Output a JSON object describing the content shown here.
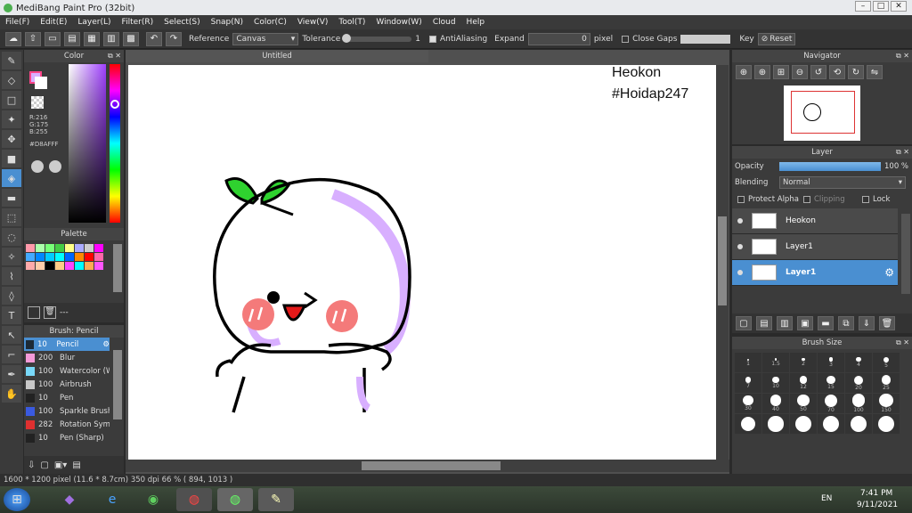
{
  "window": {
    "title": "MediBang Paint Pro (32bit)"
  },
  "menu": [
    "File(F)",
    "Edit(E)",
    "Layer(L)",
    "Filter(R)",
    "Select(S)",
    "Snap(N)",
    "Color(C)",
    "View(V)",
    "Tool(T)",
    "Window(W)",
    "Cloud",
    "Help"
  ],
  "toolbar": {
    "reference_label": "Reference",
    "reference_value": "Canvas",
    "tolerance_label": "Tolerance",
    "tolerance_value": "1",
    "antialiasing_label": "AntiAliasing",
    "expand_label": "Expand",
    "expand_value": "0",
    "expand_unit": "pixel",
    "close_gaps_label": "Close Gaps",
    "key_label": "Key",
    "reset_label": "Reset"
  },
  "color_panel": {
    "title": "Color",
    "r": "R:216",
    "g": "G:175",
    "b": "B:255",
    "hex": "#D8AFFF",
    "fg_color": "#D8AFFF"
  },
  "palette_panel": {
    "title": "Palette",
    "tail_text": "---",
    "swatches": [
      "#f9a",
      "#afa",
      "#7f7",
      "#4c4",
      "#ff8",
      "#aaf",
      "#ccc",
      "#f0f",
      "#4af",
      "#08f",
      "#0cf",
      "#0ff",
      "#06f",
      "#f80",
      "#f00",
      "#f6a",
      "#faa",
      "#fca",
      "#000",
      "#fc8",
      "#f4f",
      "#0ff",
      "#fa5",
      "#f5f"
    ]
  },
  "brush_panel": {
    "title": "Brush: Pencil",
    "brushes": [
      {
        "size": "10",
        "name": "Pencil",
        "color": "#1d2a36"
      },
      {
        "size": "200",
        "name": "Blur",
        "color": "#f49ad8"
      },
      {
        "size": "100",
        "name": "Watercolor (W",
        "color": "#78d8f8"
      },
      {
        "size": "100",
        "name": "Airbrush",
        "color": "#c8c8c8"
      },
      {
        "size": "10",
        "name": "Pen",
        "color": "#222"
      },
      {
        "size": "100",
        "name": "Sparkle Brush",
        "color": "#3a5ae0"
      },
      {
        "size": "282",
        "name": "Rotation Sym",
        "color": "#e03030"
      },
      {
        "size": "10",
        "name": "Pen (Sharp)",
        "color": "#222"
      }
    ]
  },
  "document": {
    "tab": "Untitled",
    "note_line1": "Heokon",
    "note_line2": "#Hoidap247"
  },
  "navigator": {
    "title": "Navigator"
  },
  "layer_panel": {
    "title": "Layer",
    "opacity_label": "Opacity",
    "opacity_value": "100 %",
    "opacity_fraction": 1.0,
    "blending_label": "Blending",
    "blending_value": "Normal",
    "protect_alpha": "Protect Alpha",
    "clipping": "Clipping",
    "lock": "Lock",
    "layers": [
      {
        "name": "Heokon",
        "active": false
      },
      {
        "name": "Layer1",
        "active": false
      },
      {
        "name": "Layer1",
        "active": true
      }
    ]
  },
  "brush_size_panel": {
    "title": "Brush Size",
    "sizes": [
      "1",
      "1.5",
      "2",
      "3",
      "4",
      "5",
      "7",
      "10",
      "12",
      "15",
      "20",
      "25",
      "30",
      "40",
      "50",
      "70",
      "100",
      "150",
      "",
      "",
      "",
      "",
      "",
      ""
    ]
  },
  "status": {
    "text": "1600 * 1200 pixel  (11.6 * 8.7cm)  350 dpi  66 %  ( 894, 1013 )"
  },
  "taskbar": {
    "lang": "EN",
    "time": "7:41 PM",
    "date": "9/11/2021"
  }
}
